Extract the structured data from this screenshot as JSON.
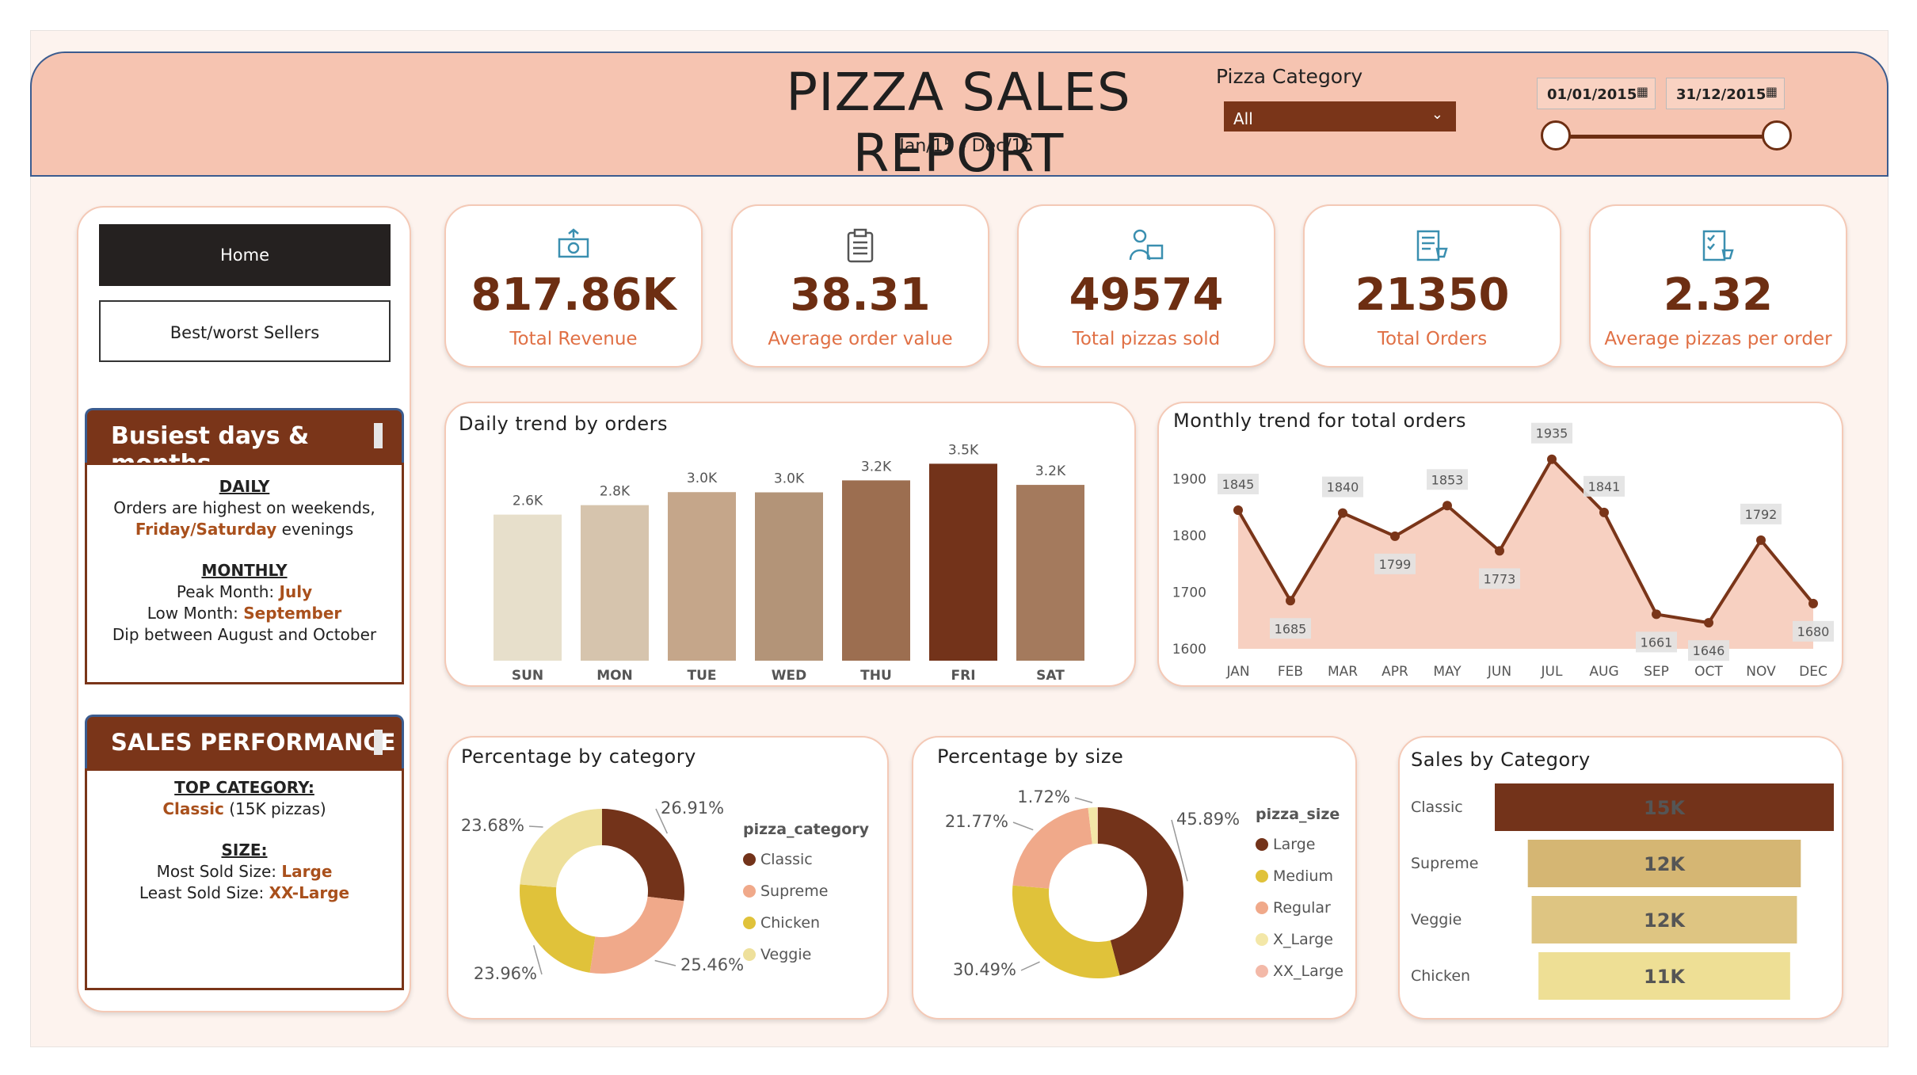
{
  "header": {
    "title": "PIZZA SALES REPORT",
    "subtitle": "Jan/15 - Dec/15",
    "category_label": "Pizza Category",
    "category_value": "All",
    "date_from": "01/01/2015",
    "date_to": "31/12/2015"
  },
  "nav": {
    "home": "Home",
    "best": "Best/worst Sellers"
  },
  "busiest": {
    "title": "Busiest days & months",
    "daily_head": "DAILY",
    "daily_text": "Orders are highest on weekends,",
    "daily_em": "Friday/Saturday",
    "daily_tail": "evenings",
    "monthly_head": "MONTHLY",
    "peak_label": "Peak Month:",
    "peak_value": "July",
    "low_label": "Low Month:",
    "low_value": "September",
    "dip_text": "Dip between August and October"
  },
  "sales_perf": {
    "title": "SALES PERFORMANCE",
    "top_head": "TOP CATEGORY:",
    "top_value": "Classic",
    "top_detail": "(15K pizzas)",
    "size_head": "SIZE:",
    "most_label": "Most Sold Size:",
    "most_value": "Large",
    "least_label": "Least Sold Size:",
    "least_value": "XX-Large"
  },
  "kpis": [
    {
      "value": "817.86K",
      "label": "Total Revenue",
      "icon": "money-icon"
    },
    {
      "value": "38.31",
      "label": "Average order value",
      "icon": "clipboard-icon"
    },
    {
      "value": "49574",
      "label": "Total pizzas sold",
      "icon": "delivery-icon"
    },
    {
      "value": "21350",
      "label": "Total Orders",
      "icon": "order-list-icon"
    },
    {
      "value": "2.32",
      "label": "Average pizzas per order",
      "icon": "order-checklist-icon"
    }
  ],
  "colors": {
    "brown": "#7a3519",
    "salmon": "#f6c4b1",
    "accent_text": "#e07045"
  },
  "chart_data": [
    {
      "type": "bar",
      "title": "Daily trend by orders",
      "categories": [
        "SUN",
        "MON",
        "TUE",
        "WED",
        "THU",
        "FRI",
        "SAT"
      ],
      "values": [
        2624,
        2794,
        3028,
        3024,
        3239,
        3538,
        3158
      ],
      "data_labels": [
        "2.6K",
        "2.8K",
        "3.0K",
        "3.0K",
        "3.2K",
        "3.5K",
        "3.2K"
      ],
      "colors": [
        "#e7dfcb",
        "#d6c4ad",
        "#c5a68a",
        "#b39478",
        "#9c6e50",
        "#73331a",
        "#a47a5d"
      ],
      "ylim": [
        0,
        3700
      ]
    },
    {
      "type": "area",
      "title": "Monthly trend for total orders",
      "categories": [
        "JAN",
        "FEB",
        "MAR",
        "APR",
        "MAY",
        "JUN",
        "JUL",
        "AUG",
        "SEP",
        "OCT",
        "NOV",
        "DEC"
      ],
      "values": [
        1845,
        1685,
        1840,
        1799,
        1853,
        1773,
        1935,
        1841,
        1661,
        1646,
        1792,
        1680
      ],
      "yticks": [
        1600,
        1700,
        1800,
        1900
      ],
      "ylim": [
        1600,
        1950
      ]
    },
    {
      "type": "pie",
      "title": "Percentage by category",
      "legend_title": "pizza_category",
      "labels": [
        "Classic",
        "Supreme",
        "Chicken",
        "Veggie"
      ],
      "values": [
        26.91,
        25.46,
        23.96,
        23.68
      ],
      "value_labels": [
        "26.91%",
        "25.46%",
        "23.96%",
        "23.68%"
      ],
      "colors": [
        "#73331a",
        "#f0a98a",
        "#e0c23a",
        "#eee09b"
      ]
    },
    {
      "type": "pie",
      "title": "Percentage by size",
      "legend_title": "pizza_size",
      "labels": [
        "Large",
        "Medium",
        "Regular",
        "X_Large",
        "XX_Large"
      ],
      "values": [
        45.89,
        30.49,
        21.77,
        1.72,
        0.12
      ],
      "value_labels": [
        "45.89%",
        "30.49%",
        "21.77%",
        "1.72%",
        ""
      ],
      "colors": [
        "#73331a",
        "#e0c23a",
        "#f0a98a",
        "#f3e7a8",
        "#f3b9a8"
      ]
    },
    {
      "type": "bar",
      "title": "Sales by Category",
      "categories": [
        "Classic",
        "Supreme",
        "Veggie",
        "Chicken"
      ],
      "values": [
        14888,
        11987,
        11649,
        11050
      ],
      "data_labels": [
        "15K",
        "12K",
        "12K",
        "11K"
      ],
      "colors": [
        "#73331a",
        "#d5b673",
        "#dec582",
        "#eedf95"
      ]
    }
  ]
}
